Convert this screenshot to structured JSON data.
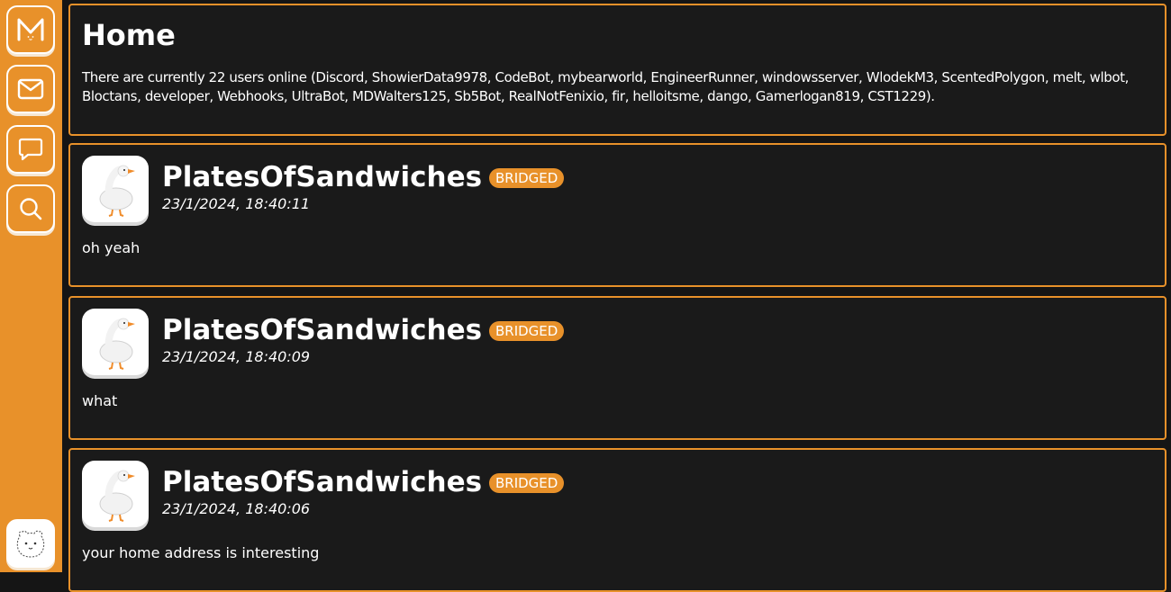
{
  "sidebar": {
    "items": [
      {
        "name": "meower-logo-icon"
      },
      {
        "name": "mail-icon"
      },
      {
        "name": "chat-icon"
      },
      {
        "name": "search-icon"
      }
    ],
    "profile": {
      "name": "avatar"
    }
  },
  "home": {
    "title": "Home",
    "online_text": "There are currently 22 users online (Discord, ShowierData9978, CodeBot, mybearworld, EngineerRunner, windowsserver, WlodekM3, ScentedPolygon, melt, wlbot, Bloctans, developer, Webhooks, UltraBot, MDWalters125, Sb5Bot, RealNotFenixio, fir, helloitsme, dango, Gamerlogan819, CST1229)."
  },
  "posts": [
    {
      "user": "PlatesOfSandwiches",
      "badge": "BRIDGED",
      "time": "23/1/2024, 18:40:11",
      "content": "oh yeah"
    },
    {
      "user": "PlatesOfSandwiches",
      "badge": "BRIDGED",
      "time": "23/1/2024, 18:40:09",
      "content": "what"
    },
    {
      "user": "PlatesOfSandwiches",
      "badge": "BRIDGED",
      "time": "23/1/2024, 18:40:06",
      "content": "your home address is interesting"
    }
  ],
  "colors": {
    "accent": "#e8912a",
    "background": "#151515",
    "card": "#1a1a1a",
    "text": "#ffffff"
  }
}
